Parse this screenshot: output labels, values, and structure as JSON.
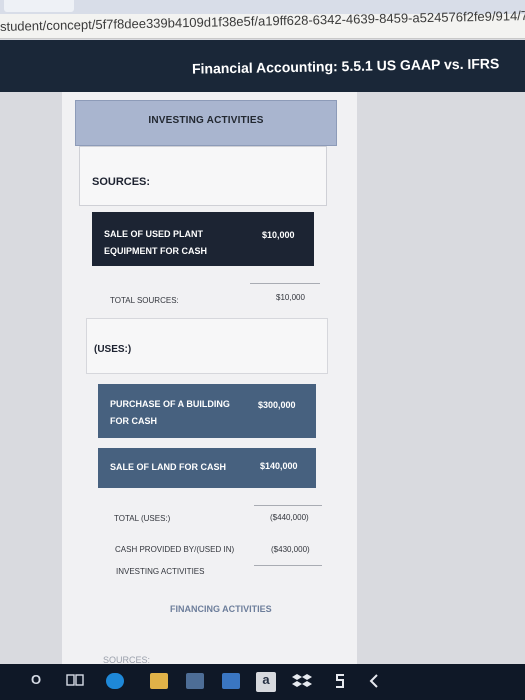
{
  "browser": {
    "url": "student/concept/5f7f8dee339b4109d1f38e5f/a19ff628-6342-4639-8459-a524576f2fe9/914/7"
  },
  "header": {
    "title": "Financial Accounting: 5.5.1 US GAAP vs. IFRS"
  },
  "investing": {
    "section_title": "INVESTING ACTIVITIES",
    "sources_label": "SOURCES:",
    "source_item": {
      "line1": "SALE OF USED PLANT",
      "line2": "EQUIPMENT FOR CASH",
      "amount": "$10,000"
    },
    "total_sources_label": "TOTAL SOURCES:",
    "total_sources_amount": "$10,000",
    "uses_label": "(USES:)",
    "use_items": [
      {
        "line1": "PURCHASE OF A BUILDING",
        "line2": "FOR CASH",
        "amount": "$300,000"
      },
      {
        "line1": "SALE OF LAND FOR CASH",
        "amount": "$140,000"
      }
    ],
    "total_uses_label": "TOTAL (USES:)",
    "total_uses_amount": "($440,000)",
    "cash_provided_line1": "CASH PROVIDED BY/(USED IN)",
    "cash_provided_line2": "INVESTING ACTIVITIES",
    "cash_provided_amount": "($430,000)"
  },
  "financing": {
    "section_title": "FINANCING ACTIVITIES",
    "sources_label": "SOURCES:"
  },
  "taskbar": {
    "search_glyph": "O",
    "store_glyph": "a"
  }
}
